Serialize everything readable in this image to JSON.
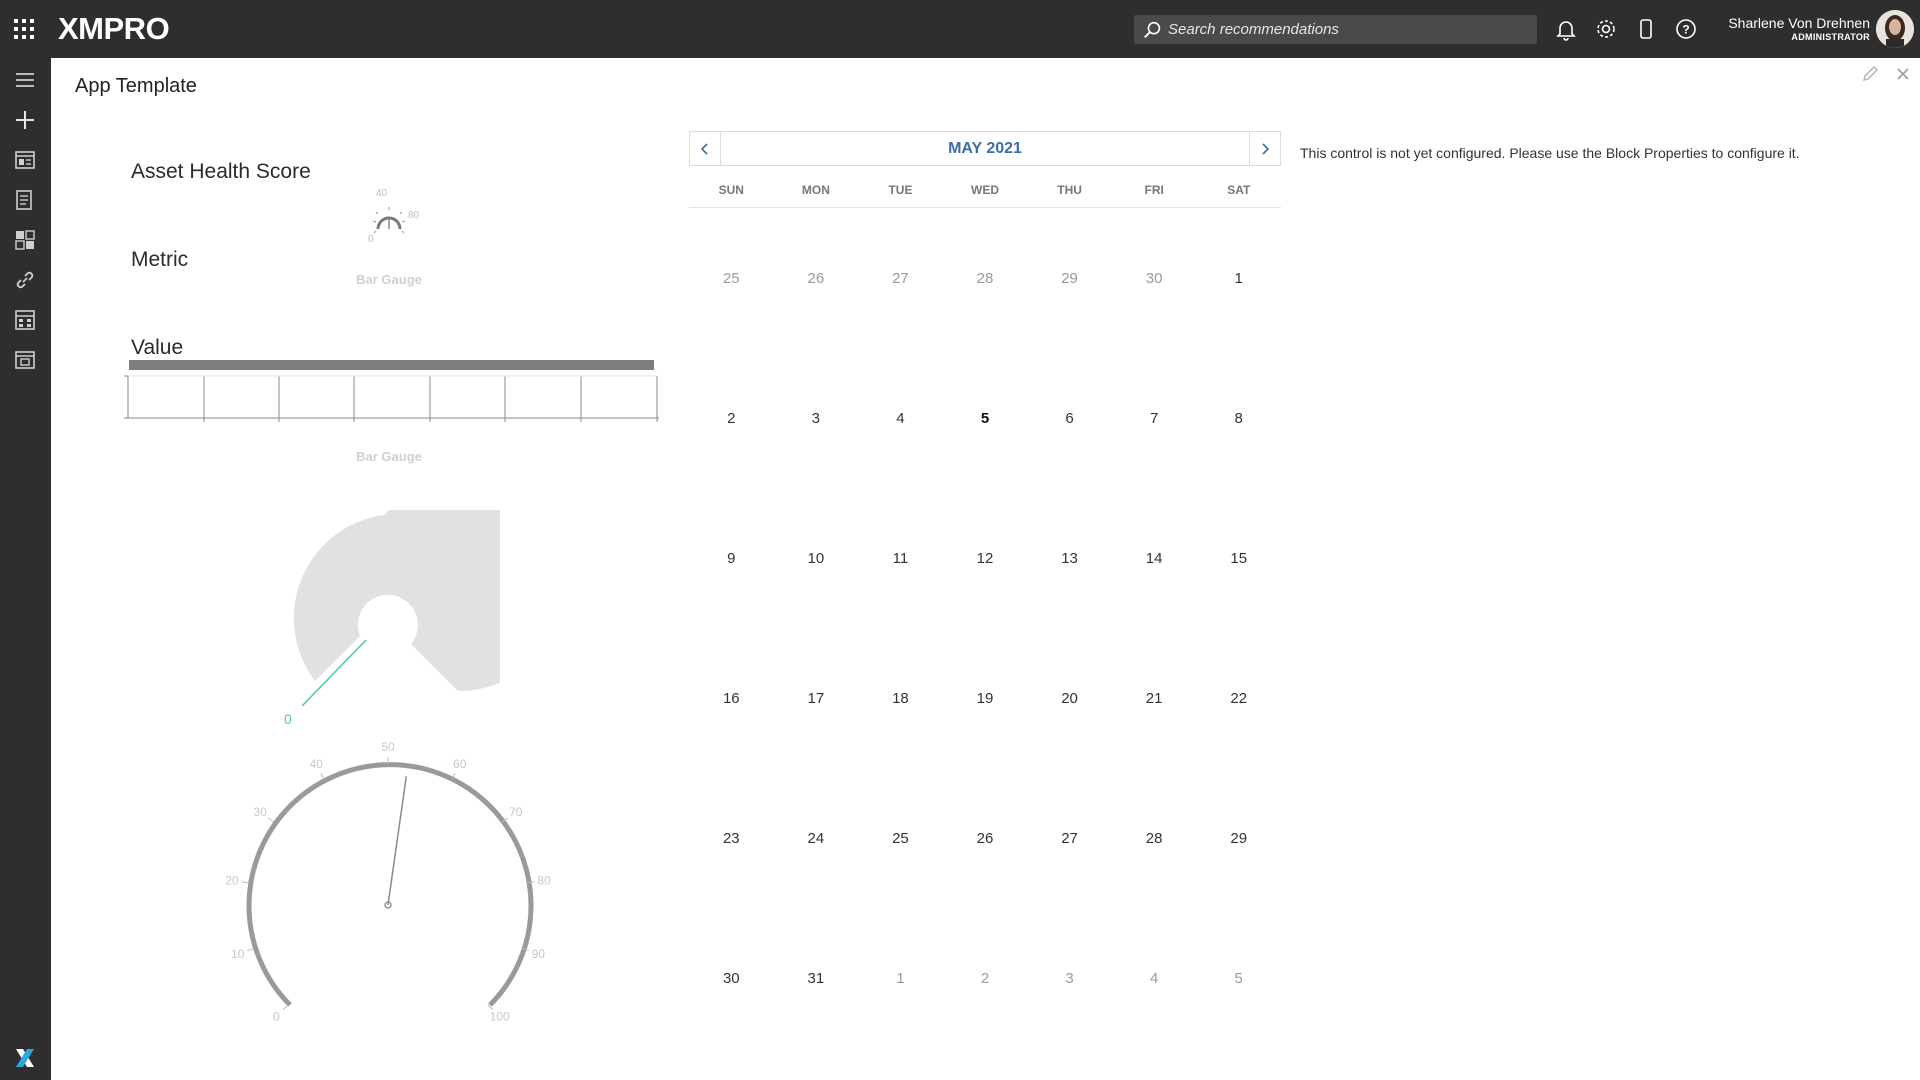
{
  "header": {
    "logo_text": "XMPRO",
    "search": {
      "placeholder": "Search recommendations"
    },
    "user": {
      "name": "Sharlene Von Drehnen",
      "role": "ADMINISTRATOR"
    }
  },
  "page": {
    "title": "App Template"
  },
  "widgets": {
    "asset_health_label": "Asset Health Score",
    "metric_label": "Metric",
    "value_label": "Value",
    "bar_gauge_caption_1": "Bar Gauge",
    "bar_gauge_caption_2": "Bar Gauge",
    "small_gauge_ticks": [
      "40",
      "80",
      "0"
    ],
    "radial_value": "0",
    "circular_gauge": {
      "ticks": [
        "0",
        "10",
        "20",
        "30",
        "40",
        "50",
        "60",
        "70",
        "80",
        "90",
        "100"
      ],
      "needle_value": 53
    }
  },
  "calendar": {
    "title": "MAY 2021",
    "weekdays": [
      "SUN",
      "MON",
      "TUE",
      "WED",
      "THU",
      "FRI",
      "SAT"
    ],
    "days": [
      {
        "d": "25",
        "o": true
      },
      {
        "d": "26",
        "o": true
      },
      {
        "d": "27",
        "o": true
      },
      {
        "d": "28",
        "o": true
      },
      {
        "d": "29",
        "o": true
      },
      {
        "d": "30",
        "o": true
      },
      {
        "d": "1",
        "o": false
      },
      {
        "d": "2",
        "o": false
      },
      {
        "d": "3",
        "o": false
      },
      {
        "d": "4",
        "o": false
      },
      {
        "d": "5",
        "o": false,
        "t": true
      },
      {
        "d": "6",
        "o": false
      },
      {
        "d": "7",
        "o": false
      },
      {
        "d": "8",
        "o": false
      },
      {
        "d": "9",
        "o": false
      },
      {
        "d": "10",
        "o": false
      },
      {
        "d": "11",
        "o": false
      },
      {
        "d": "12",
        "o": false
      },
      {
        "d": "13",
        "o": false
      },
      {
        "d": "14",
        "o": false
      },
      {
        "d": "15",
        "o": false
      },
      {
        "d": "16",
        "o": false
      },
      {
        "d": "17",
        "o": false
      },
      {
        "d": "18",
        "o": false
      },
      {
        "d": "19",
        "o": false
      },
      {
        "d": "20",
        "o": false
      },
      {
        "d": "21",
        "o": false
      },
      {
        "d": "22",
        "o": false
      },
      {
        "d": "23",
        "o": false
      },
      {
        "d": "24",
        "o": false
      },
      {
        "d": "25",
        "o": false
      },
      {
        "d": "26",
        "o": false
      },
      {
        "d": "27",
        "o": false
      },
      {
        "d": "28",
        "o": false
      },
      {
        "d": "29",
        "o": false
      },
      {
        "d": "30",
        "o": false
      },
      {
        "d": "31",
        "o": false
      },
      {
        "d": "1",
        "o": true
      },
      {
        "d": "2",
        "o": true
      },
      {
        "d": "3",
        "o": true
      },
      {
        "d": "4",
        "o": true
      },
      {
        "d": "5",
        "o": true
      }
    ]
  },
  "notice": "This control is not yet configured. Please use the Block Properties to configure it.",
  "colors": {
    "header_bg": "#2e2e2e",
    "accent_blue": "#3b6fa3",
    "radial_green": "#4cc9a0",
    "logo_x": "#29a8e0"
  },
  "icons": {
    "top": [
      "apps-grid-icon",
      "search-icon",
      "bell-icon",
      "gear-icon",
      "mobile-icon",
      "help-icon"
    ],
    "sidebar": [
      "menu-icon",
      "plus-icon",
      "apps-icon",
      "list-icon",
      "dashboard-icon",
      "link-icon",
      "calculator-icon",
      "template-icon",
      "xmpro-x-icon"
    ]
  }
}
